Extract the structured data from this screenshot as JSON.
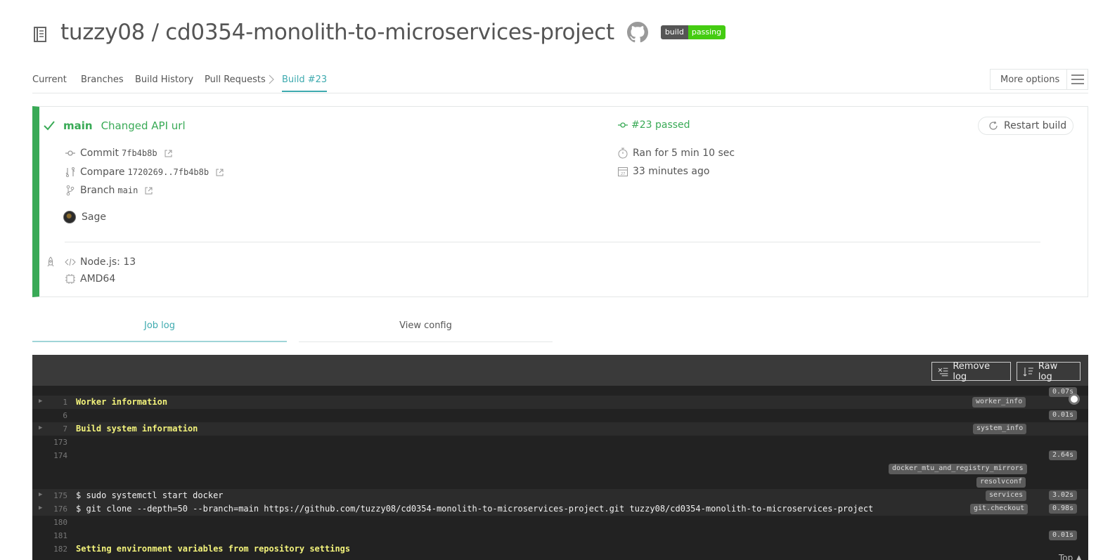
{
  "header": {
    "repo_title": "tuzzy08 / cd0354-monolith-to-microservices-project",
    "badge_left": "build",
    "badge_right": "passing"
  },
  "tabs": {
    "current": "Current",
    "branches": "Branches",
    "build_history": "Build History",
    "pull_requests": "Pull Requests",
    "build": "Build #23",
    "more_options": "More options"
  },
  "build": {
    "branch": "main",
    "message": "Changed API url",
    "commit_label": "Commit",
    "commit_sha": "7fb4b8b",
    "compare_label": "Compare",
    "compare_range": "1720269..7fb4b8b",
    "branch_label": "Branch",
    "branch_name": "main",
    "author": "Sage",
    "status": "#23 passed",
    "duration": "Ran for 5 min 10 sec",
    "finished": "33 minutes ago",
    "restart_label": "Restart build",
    "language": "Node.js: 13",
    "arch": "AMD64"
  },
  "log_tabs": {
    "job_log": "Job log",
    "view_config": "View config"
  },
  "log": {
    "remove_log": "Remove log",
    "raw_log": "Raw log",
    "top_label": "Top",
    "lines": [
      {
        "num": "1",
        "text": "Worker information",
        "tag": "worker_info",
        "dur": "0.07s"
      },
      {
        "num": "6",
        "text": "",
        "tag": "",
        "dur": "0.01s"
      },
      {
        "num": "7",
        "text": "Build system information",
        "tag": "system_info",
        "dur": ""
      },
      {
        "num": "173",
        "text": "",
        "tag": "",
        "dur": ""
      },
      {
        "num": "174",
        "text": "",
        "tag": "",
        "dur": "2.64s"
      },
      {
        "num": "",
        "text": "",
        "tag": "docker_mtu_and_registry_mirrors",
        "dur": ""
      },
      {
        "num": "",
        "text": "",
        "tag": "resolvconf",
        "dur": ""
      },
      {
        "num": "175",
        "text": "$ sudo systemctl start docker",
        "tag": "services",
        "dur": "3.02s"
      },
      {
        "num": "176",
        "text": "$ git clone --depth=50 --branch=main https://github.com/tuzzy08/cd0354-monolith-to-microservices-project.git tuzzy08/cd0354-monolith-to-microservices-project",
        "tag": "git.checkout",
        "dur": "0.98s"
      },
      {
        "num": "180",
        "text": "",
        "tag": "",
        "dur": ""
      },
      {
        "num": "181",
        "text": "",
        "tag": "",
        "dur": "0.01s"
      },
      {
        "num": "182",
        "text": "Setting environment variables from repository settings",
        "tag": "",
        "dur": ""
      }
    ]
  }
}
